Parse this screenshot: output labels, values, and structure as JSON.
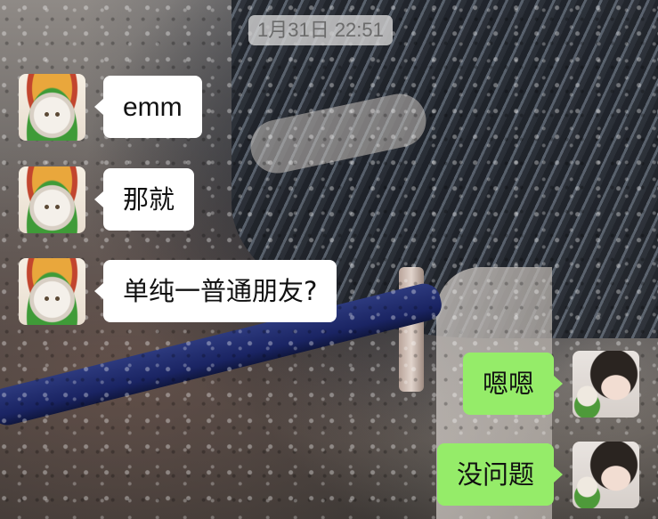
{
  "chat": {
    "timestamp": "1月31日 22:51",
    "messages": [
      {
        "direction": "received",
        "avatar": "cat-avatar",
        "text": "emm"
      },
      {
        "direction": "received",
        "avatar": "cat-avatar",
        "text": "那就"
      },
      {
        "direction": "received",
        "avatar": "cat-avatar",
        "text": "单纯一普通朋友?"
      },
      {
        "direction": "sent",
        "avatar": "girl-avatar",
        "text": "嗯嗯"
      },
      {
        "direction": "sent",
        "avatar": "girl-avatar",
        "text": "没问题"
      }
    ]
  },
  "colors": {
    "received_bubble": "#ffffff",
    "sent_bubble": "#95ec69",
    "timestamp_bg": "#d2d2d2"
  }
}
